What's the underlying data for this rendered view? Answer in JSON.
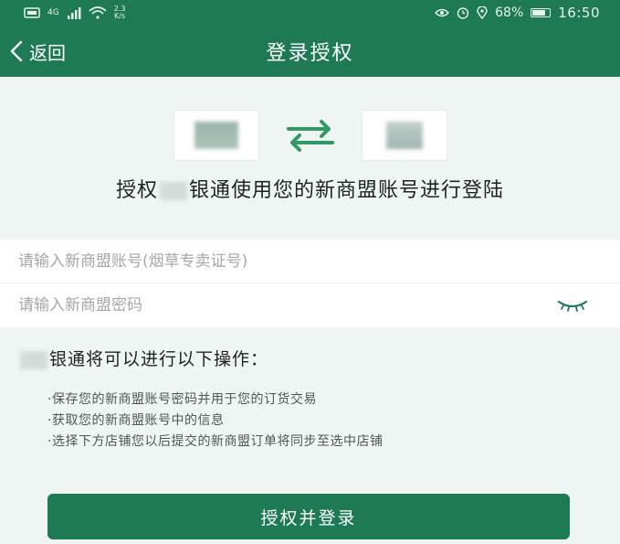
{
  "status_bar": {
    "network": "4G",
    "speed_value": "2.3",
    "speed_unit": "K/s",
    "battery": "68%",
    "time": "16:50"
  },
  "nav": {
    "back_label": "返回",
    "title": "登录授权"
  },
  "auth": {
    "text_prefix": "授权",
    "text_suffix": "银通使用您的新商盟账号进行登陆"
  },
  "form": {
    "account_placeholder": "请输入新商盟账号(烟草专卖证号)",
    "password_placeholder": "请输入新商盟密码"
  },
  "permissions": {
    "title": "银通将可以进行以下操作：",
    "items": [
      "·保存您的新商盟账号密码并用于您的订货交易",
      "·获取您的新商盟账号中的信息",
      "·选择下方店铺您以后提交的新商盟订单将同步至选中店铺"
    ]
  },
  "login_button_label": "授权并登录",
  "colors": {
    "primary": "#1e7a55",
    "background": "#eef5f3"
  }
}
